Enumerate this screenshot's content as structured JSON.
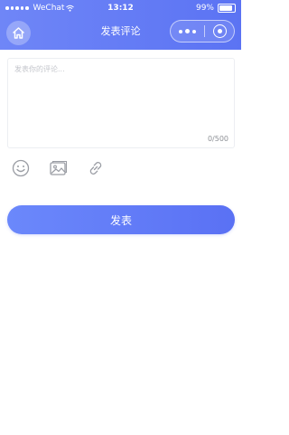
{
  "status_bar": {
    "carrier": "WeChat",
    "time": "13:12",
    "battery": "99%"
  },
  "nav": {
    "title": "发表评论"
  },
  "comment": {
    "placeholder": "发表你的评论...",
    "counter": "0/500"
  },
  "toolbar": {
    "icons": [
      "emoji-icon",
      "image-icon",
      "link-icon"
    ]
  },
  "submit": {
    "label": "发表"
  },
  "colors": {
    "accent": "#5b73f3",
    "border": "#eceef2",
    "placeholder": "#c4c6cc",
    "icon": "#9a9da4"
  }
}
